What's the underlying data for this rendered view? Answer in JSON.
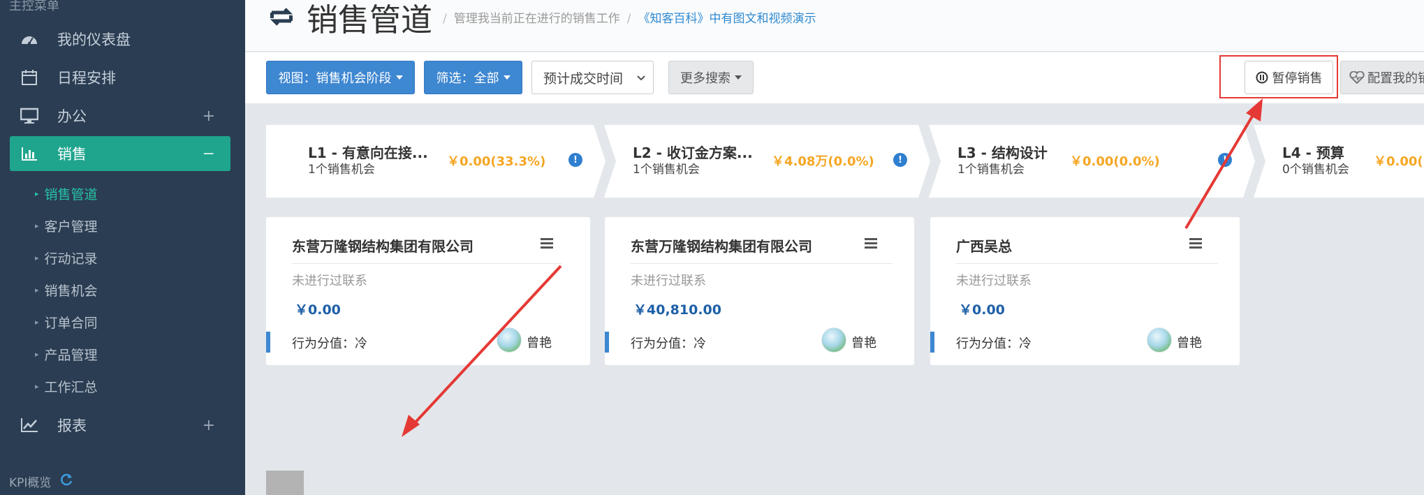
{
  "sidebar": {
    "header": "主控菜单",
    "items": [
      {
        "label": "我的仪表盘",
        "icon": "dashboard-icon"
      },
      {
        "label": "日程安排",
        "icon": "calendar-icon"
      },
      {
        "label": "办公",
        "icon": "desktop-icon",
        "toggle": "+"
      },
      {
        "label": "销售",
        "icon": "bar-chart-icon",
        "toggle": "−"
      },
      {
        "label": "报表",
        "icon": "line-chart-icon",
        "toggle": "+"
      }
    ],
    "sub_items": [
      "销售管道",
      "客户管理",
      "行动记录",
      "销售机会",
      "订单合同",
      "产品管理",
      "工作汇总"
    ],
    "current_sub": "销售管道",
    "kpi_label": "KPI概览"
  },
  "header": {
    "title": "销售管道",
    "breadcrumb_desc": "管理我当前正在进行的销售工作",
    "separator": "/",
    "link": "《知客百科》中有图文和视频演示"
  },
  "toolbar": {
    "view_label": "视图：销售机会阶段",
    "filter_label": "筛选：全部",
    "sort_select": "预计成交时间",
    "more_search": "更多搜索",
    "pause_sales": "暂停销售",
    "configure": "配置我的销"
  },
  "stages": [
    {
      "name": "L1 - 有意向在接...",
      "count": "1个销售机会",
      "amount": "￥0.00(33.3%)"
    },
    {
      "name": "L2 - 收订金方案...",
      "count": "1个销售机会",
      "amount": "￥4.08万(0.0%)"
    },
    {
      "name": "L3 - 结构设计",
      "count": "1个销售机会",
      "amount": "￥0.00(0.0%)"
    },
    {
      "name": "L4 - 预算",
      "count": "0个销售机会",
      "amount": "￥0.00("
    }
  ],
  "cards": [
    {
      "title": "东营万隆钢结构集团有限公司",
      "status": "未进行过联系",
      "amount": "￥0.00",
      "score": "行为分值：冷",
      "owner": "曾艳"
    },
    {
      "title": "东营万隆钢结构集团有限公司",
      "status": "未进行过联系",
      "amount": "￥40,810.00",
      "score": "行为分值：冷",
      "owner": "曾艳"
    },
    {
      "title": "广西吴总",
      "status": "未进行过联系",
      "amount": "￥0.00",
      "score": "行为分值：冷",
      "owner": "曾艳"
    }
  ],
  "colors": {
    "sidebar_bg": "#2b3d52",
    "sidebar_active": "#1fa58d",
    "primary_button": "#3e87d1",
    "amount_orange": "#f5a623",
    "annotation_red": "#e53935"
  }
}
